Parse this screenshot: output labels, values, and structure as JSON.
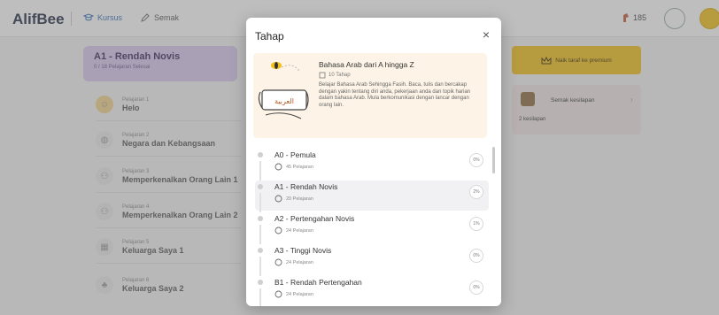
{
  "app": {
    "logo": "AlifBee",
    "nav": [
      {
        "label": "Kursus",
        "icon": "graduation-cap-icon"
      },
      {
        "label": "Semak",
        "icon": "pencil-icon"
      }
    ],
    "streak_count": "185"
  },
  "course": {
    "title": "A1 - Rendah Novis",
    "subtitle": "0 / 18 Pelajaran Selesai"
  },
  "lessons": [
    {
      "label": "Pelajaran 1",
      "name": "Helo",
      "icon": "hello-icon"
    },
    {
      "label": "Pelajaran 2",
      "name": "Negara dan Kebangsaan",
      "icon": "globe-icon"
    },
    {
      "label": "Pelajaran 3",
      "name": "Memperkenalkan Orang Lain 1",
      "icon": "people-icon"
    },
    {
      "label": "Pelajaran 4",
      "name": "Memperkenalkan Orang Lain 2",
      "icon": "people-icon"
    },
    {
      "label": "Pelajaran 5",
      "name": "Keluarga Saya 1",
      "icon": "family-icon"
    },
    {
      "label": "Pelajaran 6",
      "name": "Keluarga Saya 2",
      "icon": "tree-icon"
    }
  ],
  "sidebar": {
    "premium_label": "Naik taraf ke premium",
    "review_label": "Semak kesilapan",
    "review_count": "2 kesilapan"
  },
  "modal": {
    "title": "Tahap",
    "close_glyph": "×",
    "intro": {
      "title": "Bahasa Arab dari A hingga Z",
      "levels": "10 Tahap",
      "description": "Belajar Bahasa Arab Sehingga Fasih. Baca, tulis dan bercakap dengan yakin tentang diri anda, pekerjaan anda dan topik harian dalam bahasa Arab. Mula berkomunikasi dengan lancar dengan orang lain.",
      "badge_text": "العربية"
    },
    "levels": [
      {
        "name": "A0 - Pemula",
        "lessons": "45 Pelajaran",
        "percent": "0%",
        "selected": false
      },
      {
        "name": "A1 - Rendah Novis",
        "lessons": "20 Pelajaran",
        "percent": "2%",
        "selected": true
      },
      {
        "name": "A2 - Pertengahan Novis",
        "lessons": "24 Pelajaran",
        "percent": "1%",
        "selected": false
      },
      {
        "name": "A3 - Tinggi Novis",
        "lessons": "24 Pelajaran",
        "percent": "0%",
        "selected": false
      },
      {
        "name": "B1 - Rendah Pertengahan",
        "lessons": "24 Pelajaran",
        "percent": "0%",
        "selected": false
      }
    ]
  }
}
